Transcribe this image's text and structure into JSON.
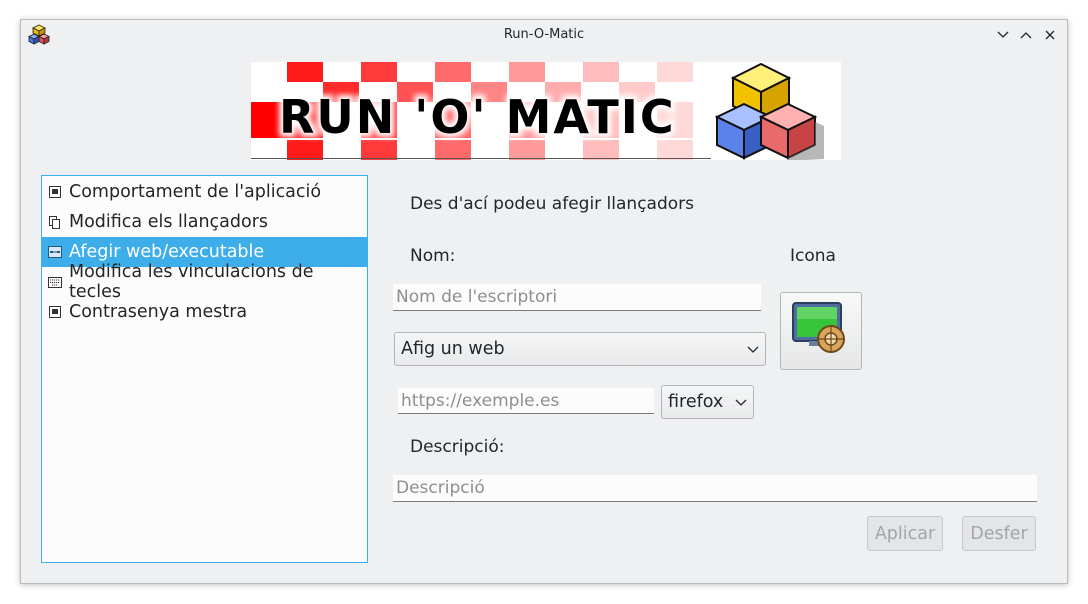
{
  "window": {
    "title": "Run-O-Matic",
    "app_icon": "cubes-icon",
    "controls": [
      "minimize-icon",
      "maximize-icon",
      "close-icon"
    ]
  },
  "banner": {
    "text": "RUN 'O' MATIC"
  },
  "sidebar": {
    "items": [
      {
        "label": "Comportament de l'aplicació",
        "icon": "window-icon",
        "active": false
      },
      {
        "label": "Modifica els llançadors",
        "icon": "copy-icon",
        "active": false
      },
      {
        "label": "Afegir web/executable",
        "icon": "network-icon",
        "active": true
      },
      {
        "label": "Modifica les vinculacions de tecles",
        "icon": "keyboard-icon",
        "active": false
      },
      {
        "label": "Contrasenya mestra",
        "icon": "window-icon",
        "active": false
      }
    ]
  },
  "main": {
    "intro": "Des d'ací podeu afegir llançadors",
    "name_label": "Nom:",
    "icon_label": "Icona",
    "name_placeholder": "Nom de l'escriptori",
    "type_select": "Afig un web",
    "url_placeholder": "https://exemple.es",
    "browser_select": "firefox",
    "description_label": "Descripció:",
    "description_placeholder": "Descripció",
    "apply_button": "Aplicar",
    "undo_button": "Desfer"
  },
  "colors": {
    "accent": "#3daee9",
    "window_bg": "#eff0f1",
    "banner_red": "#ff0000",
    "disabled_text": "#a3a5a7"
  }
}
